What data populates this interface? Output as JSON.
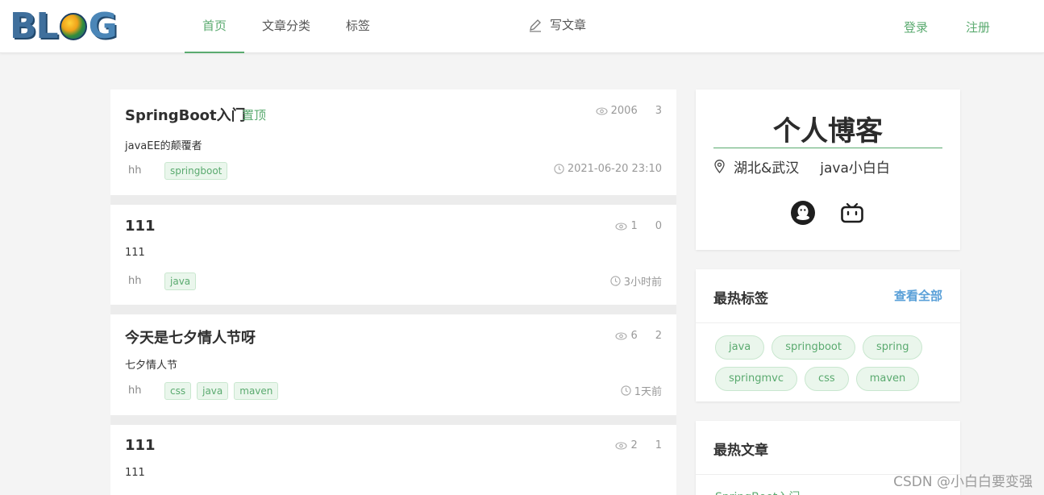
{
  "header": {
    "logo_text": "BLOG",
    "nav": [
      {
        "label": "首页",
        "active": true
      },
      {
        "label": "文章分类",
        "active": false
      },
      {
        "label": "标签",
        "active": false
      }
    ],
    "write_label": "写文章",
    "login_label": "登录",
    "register_label": "注册"
  },
  "articles": [
    {
      "title": "SpringBoot入门",
      "pinned": "置顶",
      "views": "2006",
      "comments": "3",
      "summary": "javaEE的颠覆者",
      "author": "hh",
      "tags": [
        "springboot"
      ],
      "time": "2021-06-20 23:10"
    },
    {
      "title": "111",
      "views": "1",
      "comments": "0",
      "summary": "111",
      "author": "hh",
      "tags": [
        "java"
      ],
      "time": "3小时前"
    },
    {
      "title": "今天是七夕情人节呀",
      "views": "6",
      "comments": "2",
      "summary": "七夕情人节",
      "author": "hh",
      "tags": [
        "css",
        "java",
        "maven"
      ],
      "time": "1天前"
    },
    {
      "title": "111",
      "views": "2",
      "comments": "1",
      "summary": "111"
    }
  ],
  "profile": {
    "title": "个人博客",
    "location": "湖北&武汉",
    "role": "java小白白",
    "social": [
      "qq-icon",
      "bilibili-icon"
    ]
  },
  "hot_tags": {
    "title": "最热标签",
    "more": "查看全部",
    "tags": [
      "java",
      "springboot",
      "spring",
      "springmvc",
      "css",
      "maven"
    ]
  },
  "hot_articles": {
    "title": "最热文章",
    "first": "SpringBoot入门"
  },
  "watermark": "CSDN @小白白要变强",
  "colors": {
    "accent": "#5aaa6f",
    "link_blue": "#5aa0d8",
    "background": "#f4f4f4"
  }
}
